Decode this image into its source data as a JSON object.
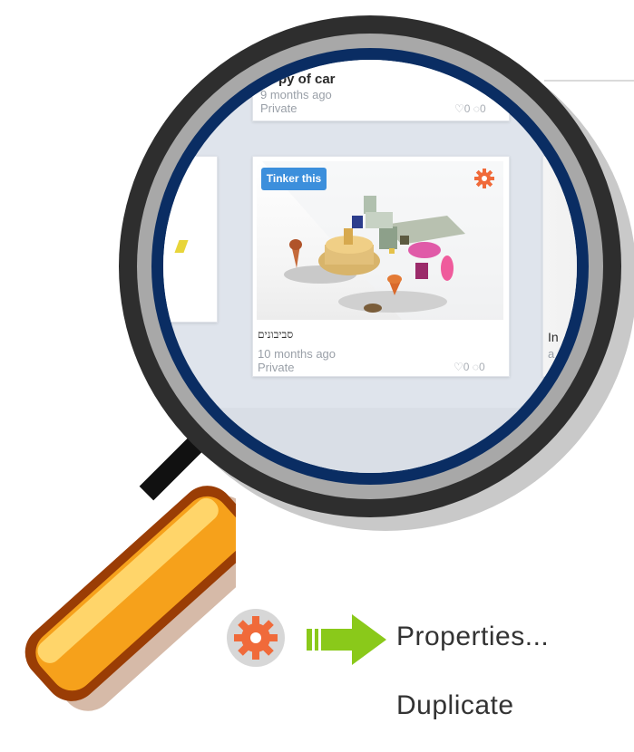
{
  "cards": {
    "top": {
      "title": "py of car",
      "time": "9 months ago",
      "visibility": "Private",
      "likes": "0",
      "comments": "0"
    },
    "featured": {
      "tinker_button": "Tinker this",
      "title": "סביבונים",
      "time": "10 months ago",
      "visibility": "Private",
      "likes": "0",
      "comments": "0"
    },
    "right": {
      "title_fragment": "In",
      "meta_fragment": "a"
    }
  },
  "menu": {
    "item1": "Properties...",
    "item2": "Duplicate"
  },
  "colors": {
    "gear": "#f06a3a",
    "tinker_blue": "#3c8fdc",
    "arrow_green": "#8ac91a",
    "lens_blue": "#0a2d63",
    "handle_orange": "#f7a41c"
  }
}
